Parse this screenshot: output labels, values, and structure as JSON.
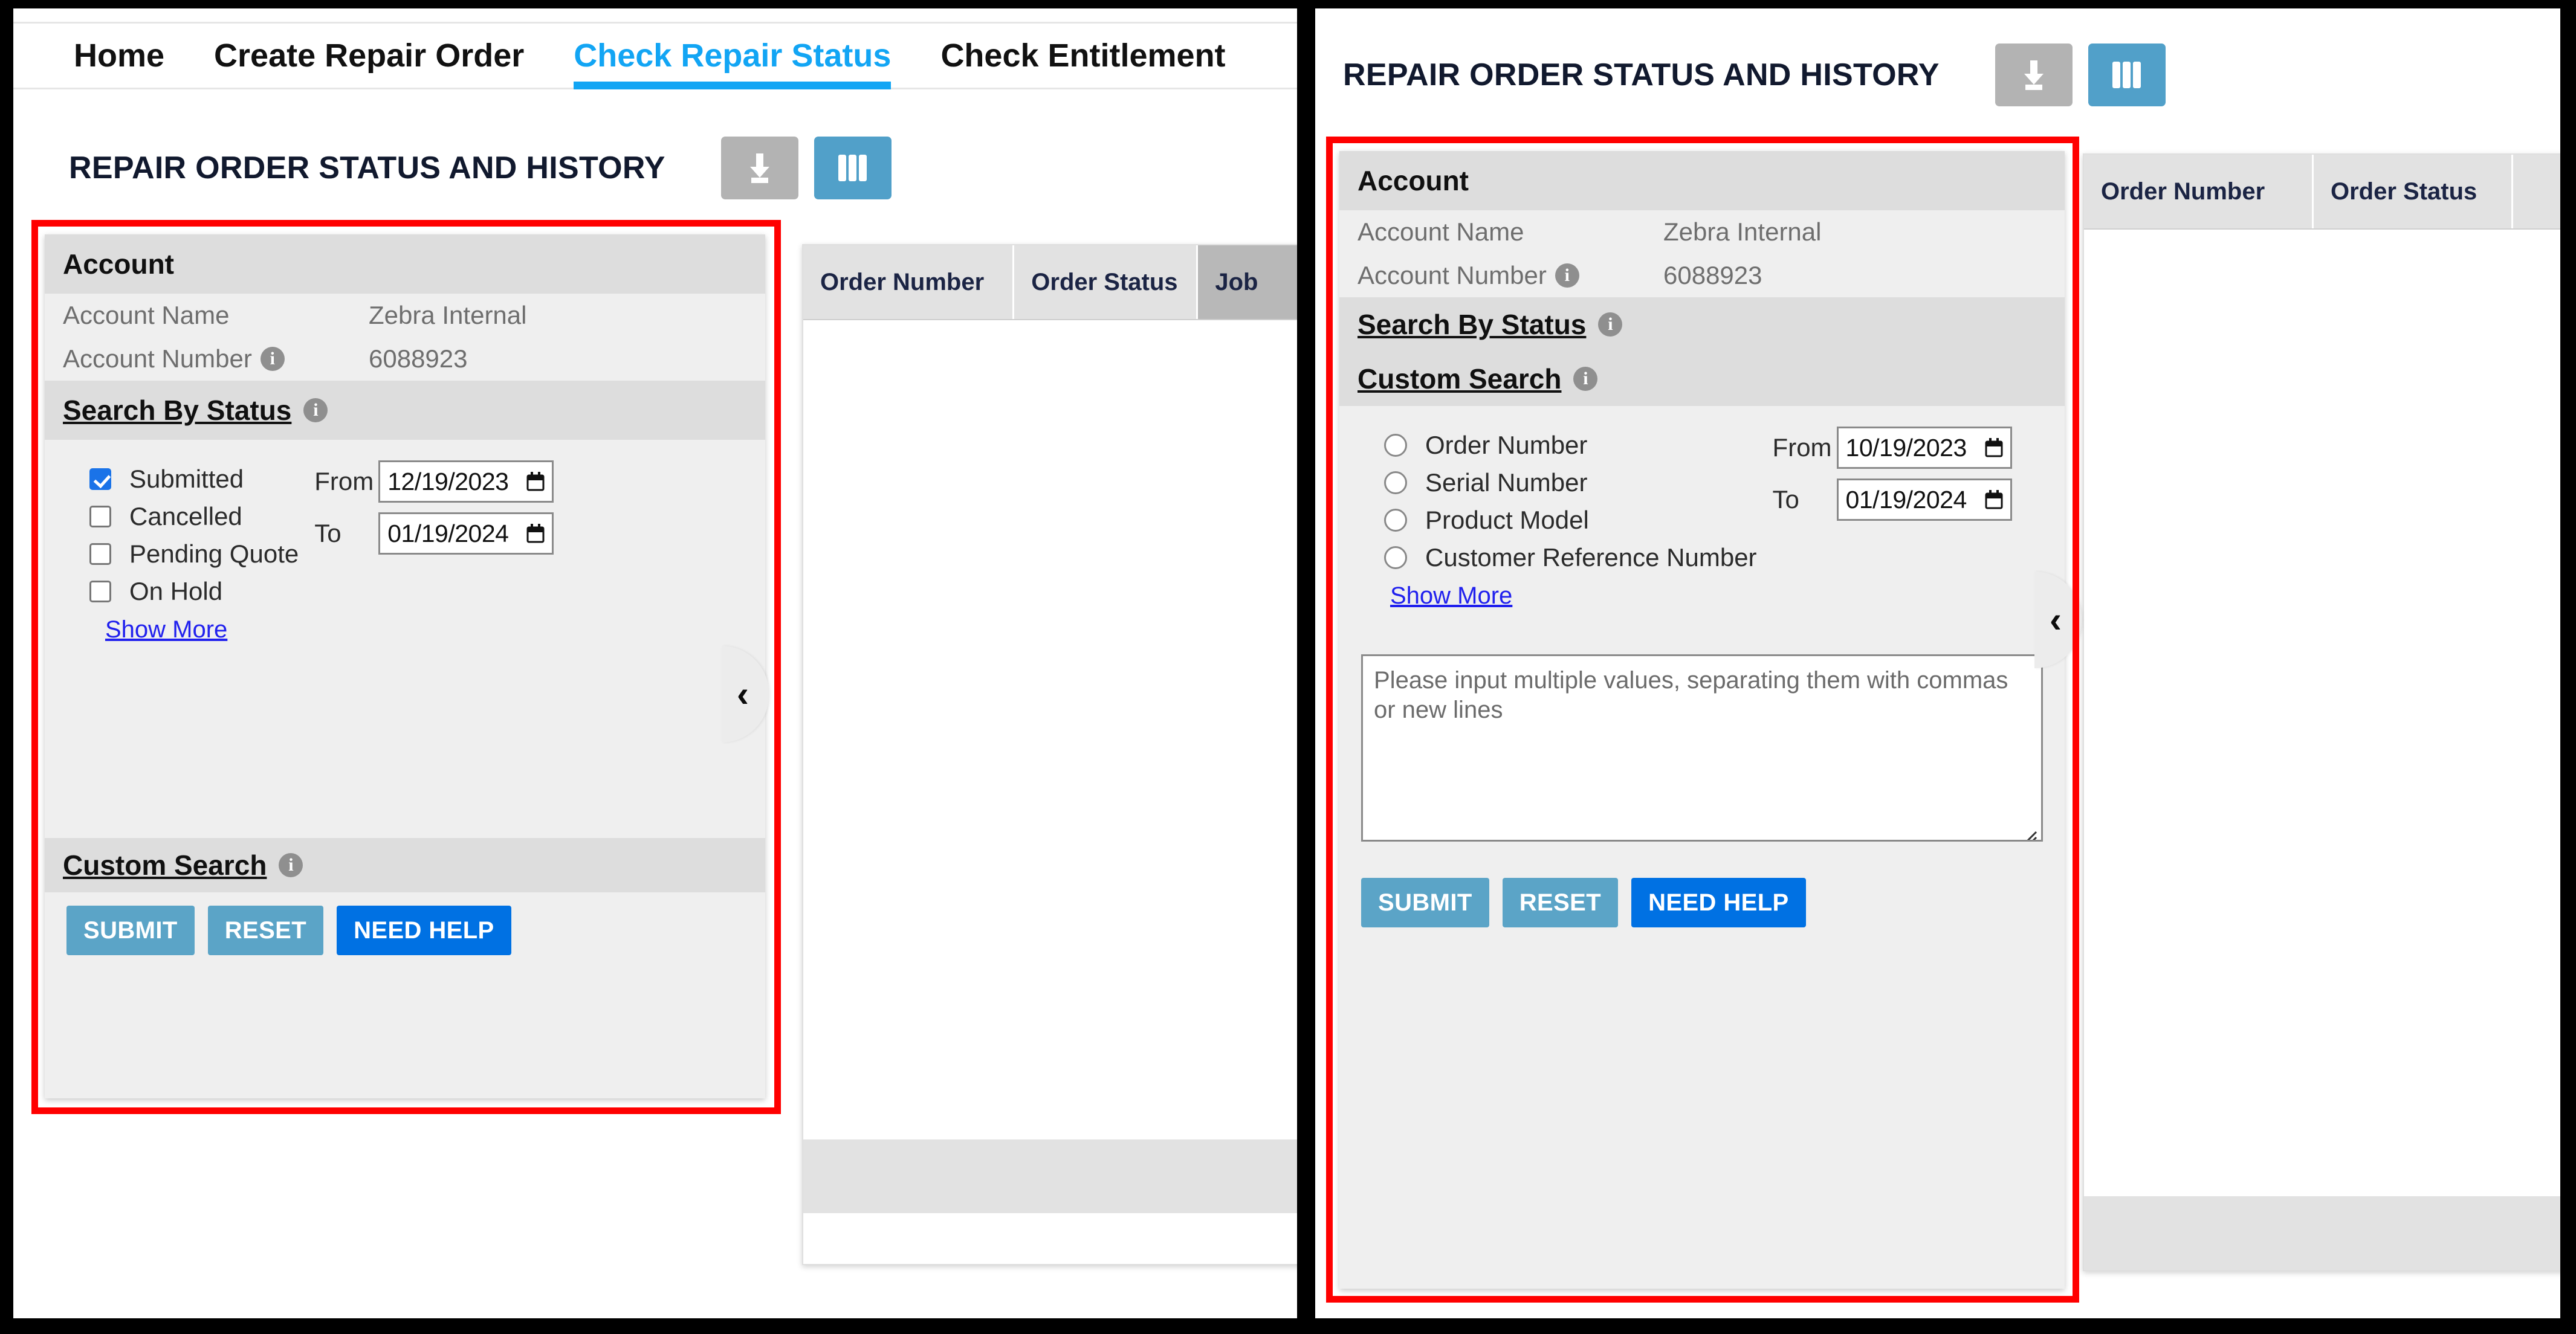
{
  "nav": {
    "items": [
      {
        "label": "Home",
        "active": false
      },
      {
        "label": "Create Repair Order",
        "active": false
      },
      {
        "label": "Check Repair Status",
        "active": true
      },
      {
        "label": "Check Entitlement",
        "active": false
      }
    ]
  },
  "header": {
    "title": "REPAIR ORDER STATUS AND HISTORY",
    "download_icon": "download-icon",
    "columns_icon": "columns-icon"
  },
  "account": {
    "section_label": "Account",
    "name_label": "Account Name",
    "name_value": "Zebra Internal",
    "number_label": "Account Number",
    "number_value": "6088923",
    "info_icon": "info-icon"
  },
  "search_by_status": {
    "label": "Search By Status",
    "info_icon": "info-icon",
    "options": [
      {
        "label": "Submitted",
        "checked": true
      },
      {
        "label": "Cancelled",
        "checked": false
      },
      {
        "label": "Pending Quote",
        "checked": false
      },
      {
        "label": "On Hold",
        "checked": false
      }
    ],
    "show_more": "Show More",
    "date_from_label": "From",
    "date_from_value": "12/19/2023",
    "date_to_label": "To",
    "date_to_value": "01/19/2024"
  },
  "custom_search": {
    "label": "Custom Search",
    "info_icon": "info-icon",
    "options": [
      {
        "label": "Order Number",
        "selected": false
      },
      {
        "label": "Serial Number",
        "selected": false
      },
      {
        "label": "Product Model",
        "selected": false
      },
      {
        "label": "Customer Reference Number",
        "selected": false
      }
    ],
    "show_more": "Show More",
    "date_from_label": "From",
    "date_from_value": "10/19/2023",
    "date_to_label": "To",
    "date_to_value": "01/19/2024",
    "textarea_placeholder": "Please input multiple values, separating them with commas or new lines",
    "textarea_value": ""
  },
  "actions": {
    "submit": "SUBMIT",
    "reset": "RESET",
    "need_help": "NEED HELP"
  },
  "results_table": {
    "columns": [
      "Order Number",
      "Order Status",
      "Job"
    ],
    "columns_right": [
      "Order Number",
      "Order Status"
    ],
    "rows": []
  },
  "collapse": {
    "chevron": "‹",
    "icon": "chevron-left-icon"
  },
  "colors": {
    "accent_blue": "#12a5f4",
    "button_blue": "#5ba4c7",
    "help_blue": "#0071e3",
    "checkbox_blue": "#1a73e8",
    "link_blue": "#2020ee",
    "annotation_red": "#ff0000",
    "panel_gray": "#efefef",
    "bar_gray": "#dddddd"
  }
}
